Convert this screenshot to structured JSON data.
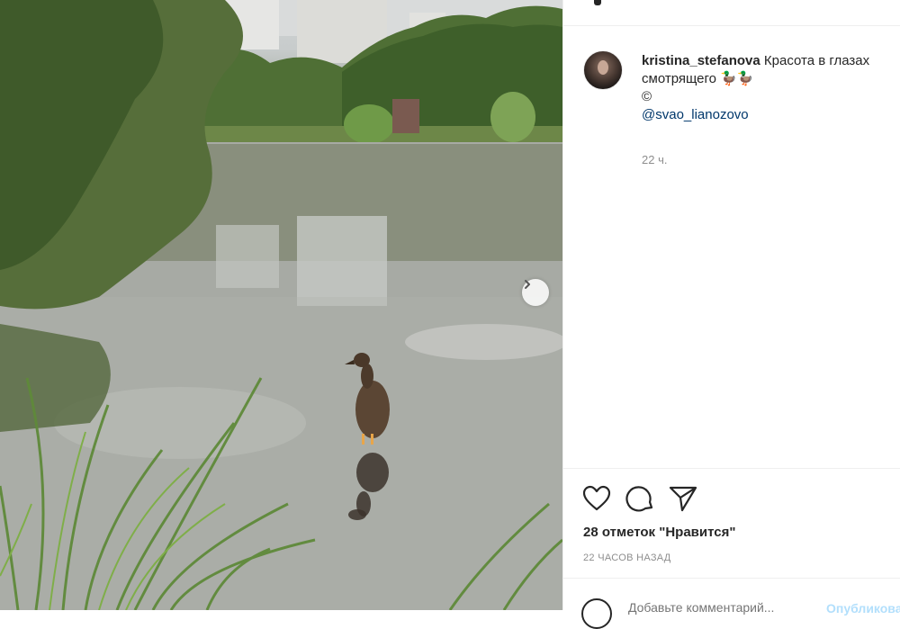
{
  "post": {
    "username": "kristina_stefanova",
    "caption_line1": "Красота в глазах",
    "caption_line2": "смотрящего 🦆🦆",
    "caption_line3": "©",
    "mention": "@svao_lianozovo",
    "caption_time": "22 ч.",
    "likes": "28 отметок \"Нравится\"",
    "post_age": "22 ЧАСОВ НАЗАД"
  },
  "comment": {
    "placeholder": "Добавьте комментарий...",
    "publish_label": "Опубликовать"
  },
  "icons": {
    "like": "heart-icon",
    "comment": "comment-icon",
    "share": "share-icon",
    "next": "chevron-right-icon",
    "emoji": "emoji-icon"
  },
  "colors": {
    "link": "#00376b",
    "muted": "#8e8e8e",
    "publish_disabled": "#b2dffc"
  }
}
